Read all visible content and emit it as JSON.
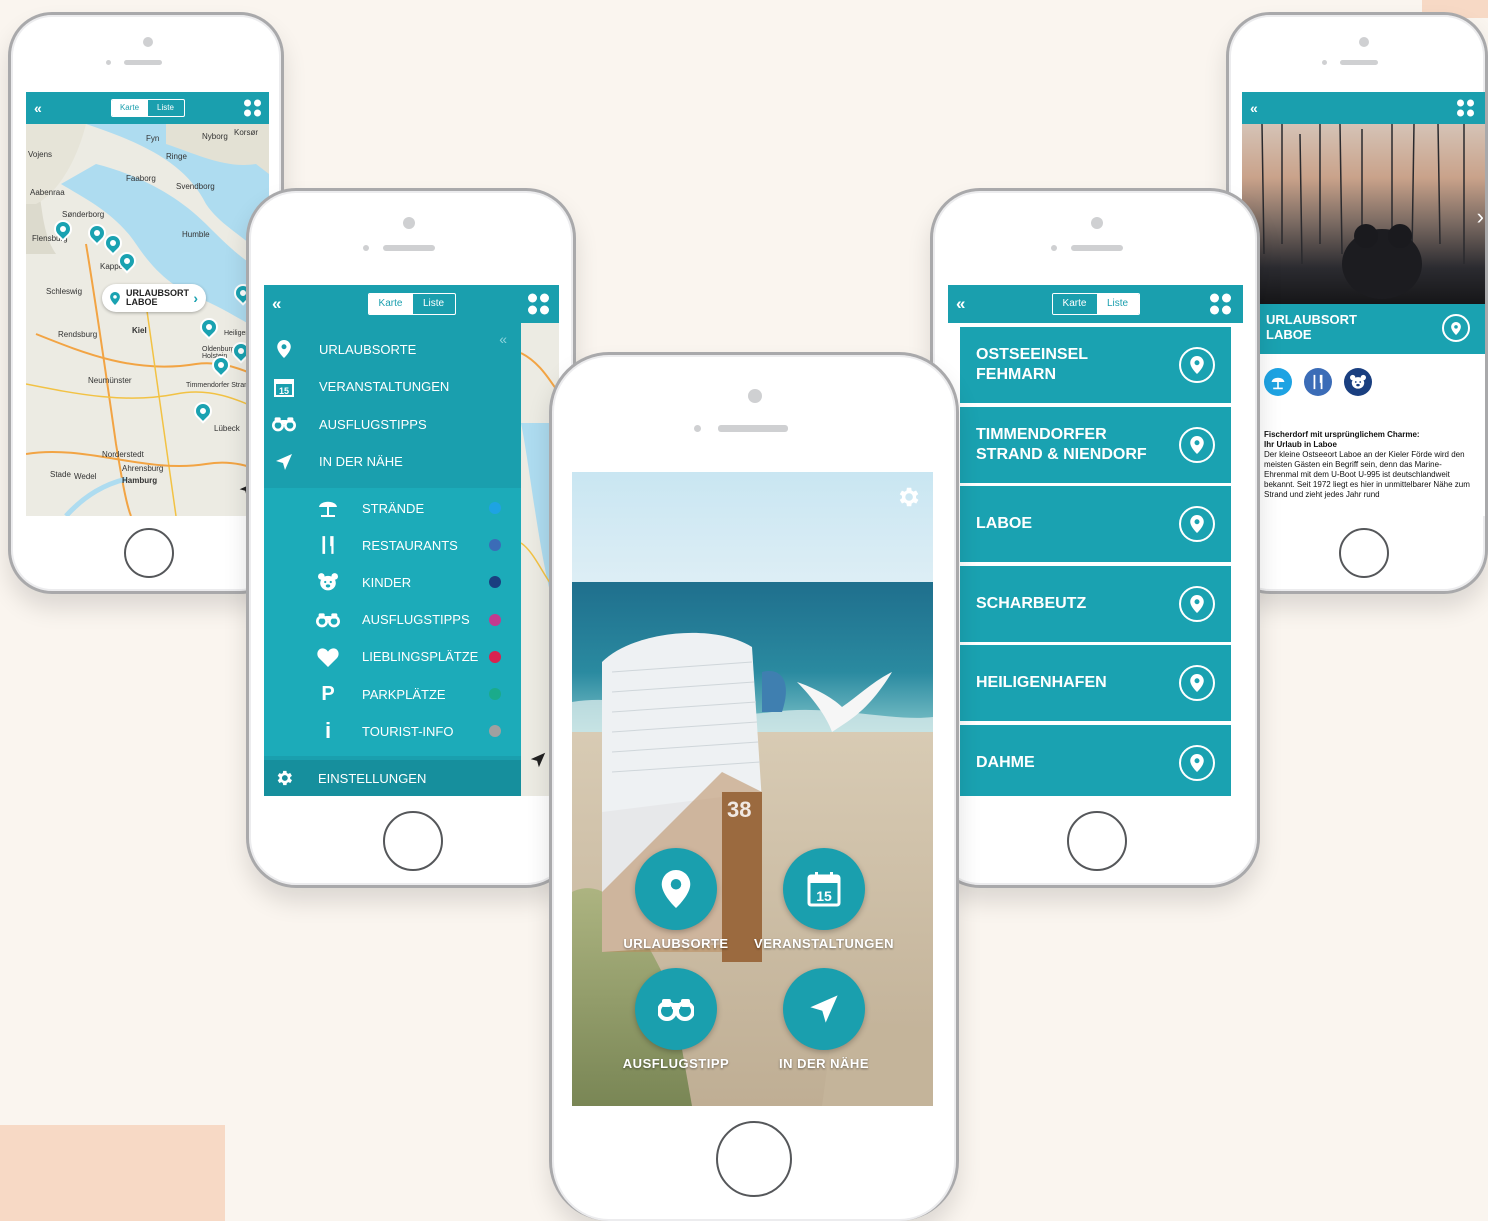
{
  "colors": {
    "accent": "#1aa2b1",
    "bar": "#1a9fae",
    "background": "#faf5ef",
    "deco": "#f7d9c5"
  },
  "map_phone": {
    "tabs": [
      "Karte",
      "Liste"
    ],
    "active_tab": "Karte",
    "callout": {
      "line1": "URLAUBSORT",
      "line2": "LABOE"
    },
    "place_labels": [
      "Sønderborg",
      "Flensburg",
      "Schleswig",
      "Rendsburg",
      "Neumünster",
      "Norderstedt",
      "Hamburg",
      "Kiel",
      "Nyborg",
      "Faaborg",
      "Svendborg",
      "Aabenraa",
      "Vojens",
      "Fyn",
      "Ahrensburg",
      "Stade",
      "Wedel",
      "Kappeln",
      "Oldenburg in Holstein",
      "Timmendorfer Strand",
      "Heiligenhafen",
      "Korsør",
      "Ringe",
      "Humble",
      "Lübeck"
    ]
  },
  "menu_phone": {
    "tabs": [
      "Karte",
      "Liste"
    ],
    "active_tab": "Karte",
    "main_items": [
      {
        "label": "URLAUBSORTE",
        "icon": "map-pin-icon"
      },
      {
        "label": "VERANSTALTUNGEN",
        "icon": "calendar-icon",
        "badge": "15"
      },
      {
        "label": "AUSFLUGSTIPPS",
        "icon": "binoculars-icon"
      },
      {
        "label": "IN DER NÄHE",
        "icon": "navigation-arrow-icon"
      }
    ],
    "sub_items": [
      {
        "label": "STRÄNDE",
        "icon": "beach-umbrella-icon",
        "color": "#1ea3e3"
      },
      {
        "label": "RESTAURANTS",
        "icon": "cutlery-icon",
        "color": "#3b6cb7"
      },
      {
        "label": "KINDER",
        "icon": "teddy-bear-icon",
        "color": "#1a3f80"
      },
      {
        "label": "AUSFLUGSTIPPS",
        "icon": "binoculars-icon",
        "color": "#c23b8f"
      },
      {
        "label": "LIEBLINGSPLÄTZE",
        "icon": "heart-icon",
        "color": "#d8224f"
      },
      {
        "label": "PARKPLÄTZE",
        "icon": "parking-icon",
        "glyph": "P",
        "color": "#1aab8b"
      },
      {
        "label": "TOURIST-INFO",
        "icon": "info-icon",
        "glyph": "i",
        "color": "#a0a0a0"
      }
    ],
    "settings": {
      "label": "EINSTELLUNGEN",
      "icon": "gear-icon"
    }
  },
  "home_phone": {
    "calendar_badge": "15",
    "basket_number": "38",
    "buttons": [
      {
        "label": "URLAUBSORTE",
        "icon": "map-pin-icon"
      },
      {
        "label": "VERANSTALTUNGEN",
        "icon": "calendar-icon"
      },
      {
        "label": "AUSFLUGSTIPP",
        "icon": "binoculars-icon"
      },
      {
        "label": "IN DER NÄHE",
        "icon": "navigation-arrow-icon"
      }
    ]
  },
  "list_phone": {
    "tabs": [
      "Karte",
      "Liste"
    ],
    "active_tab": "Liste",
    "items": [
      {
        "line1": "OSTSEEINSEL",
        "line2": "FEHMARN"
      },
      {
        "line1": "TIMMENDORFER",
        "line2": "STRAND & NIENDORF"
      },
      {
        "line1": "LABOE",
        "line2": ""
      },
      {
        "line1": "SCHARBEUTZ",
        "line2": ""
      },
      {
        "line1": "HEILIGENHAFEN",
        "line2": ""
      },
      {
        "line1": "DAHME",
        "line2": ""
      }
    ]
  },
  "detail_phone": {
    "title_line1": "URLAUBSORT",
    "title_line2": "LABOE",
    "category_icons": [
      "beach-umbrella-icon",
      "cutlery-icon",
      "teddy-bear-icon"
    ],
    "heading1": "Fischerdorf mit ursprünglichem Charme:",
    "heading2": "Ihr Urlaub in Laboe",
    "body": "Der kleine Ostseeort Laboe an der Kieler Förde wird den meisten Gästen ein Begriff sein, denn das Marine-Ehrenmal mit dem U-Boot U-995 ist deutschlandweit bekannt. Seit 1972 liegt es hier in unmittelbarer Nähe zum Strand und zieht jedes Jahr rund"
  }
}
